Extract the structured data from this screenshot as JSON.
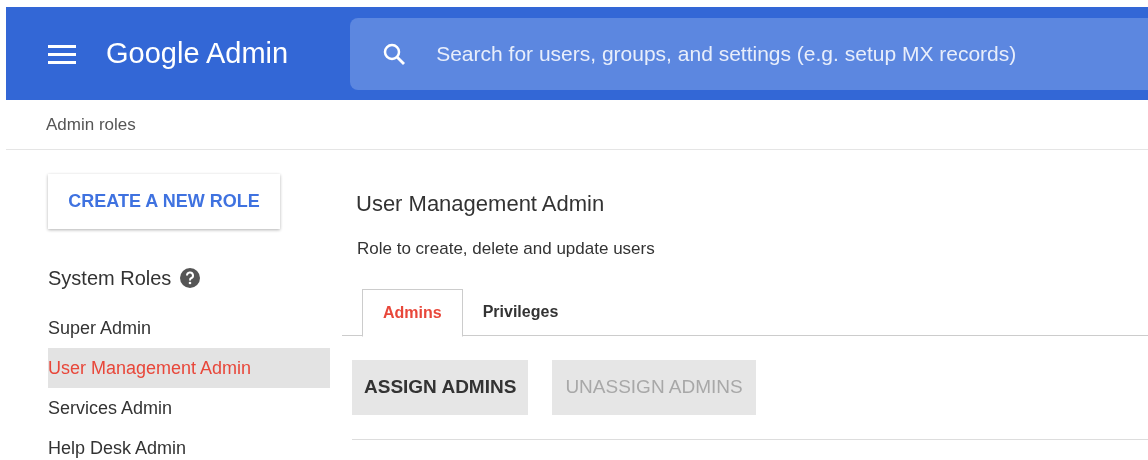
{
  "header": {
    "title": "Google Admin",
    "search": {
      "placeholder": "Search for users, groups, and settings (e.g. setup MX records)"
    }
  },
  "breadcrumb": "Admin roles",
  "sidebar": {
    "create_button": "CREATE A NEW ROLE",
    "section_title": "System Roles",
    "items": [
      {
        "label": "Super Admin",
        "selected": false
      },
      {
        "label": "User Management Admin",
        "selected": true
      },
      {
        "label": "Services Admin",
        "selected": false
      },
      {
        "label": "Help Desk Admin",
        "selected": false
      }
    ]
  },
  "role": {
    "title": "User Management Admin",
    "description": "Role to create, delete and update users",
    "tabs": [
      {
        "label": "Admins",
        "selected": true
      },
      {
        "label": "Privileges",
        "selected": false
      }
    ],
    "buttons": [
      {
        "label": "ASSIGN ADMINS",
        "disabled": false
      },
      {
        "label": "UNASSIGN ADMINS",
        "disabled": true
      }
    ]
  }
}
